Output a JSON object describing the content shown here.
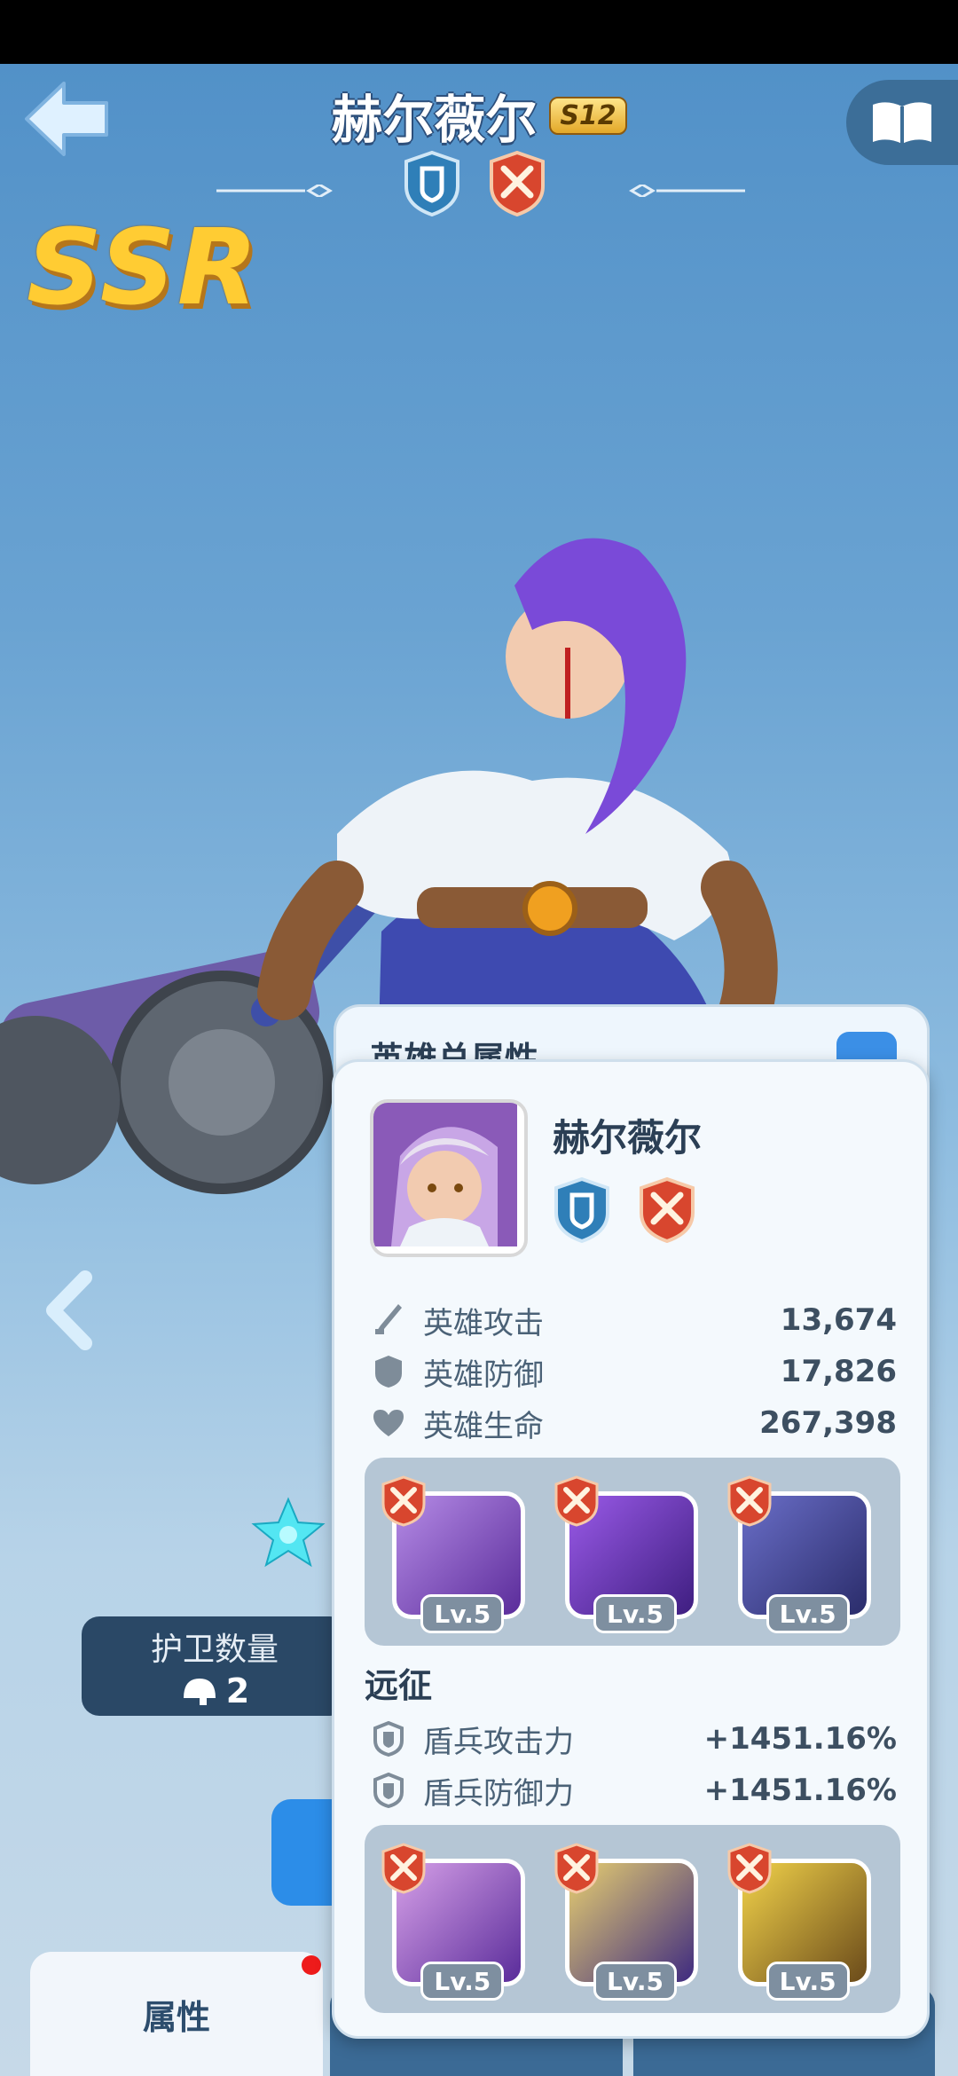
{
  "header": {
    "title": "赫尔薇尔",
    "star_badge": "S12",
    "rarity": "SSR"
  },
  "guard": {
    "label": "护卫数量",
    "value": "2"
  },
  "tabs": {
    "attributes": "属性"
  },
  "panel": {
    "back_title": "英雄总属性",
    "hero_name": "赫尔薇尔",
    "stats": [
      {
        "label": "英雄攻击",
        "value": "13,674",
        "icon": "sword-icon"
      },
      {
        "label": "英雄防御",
        "value": "17,826",
        "icon": "shield-icon"
      },
      {
        "label": "英雄生命",
        "value": "267,398",
        "icon": "heart-icon"
      }
    ],
    "skills_top": [
      {
        "level": "Lv.5",
        "color": "#7a3fb8"
      },
      {
        "level": "Lv.5",
        "color": "#5b2fa0"
      },
      {
        "level": "Lv.5",
        "color": "#3c3f8e"
      }
    ],
    "expedition_title": "远征",
    "expedition_stats": [
      {
        "label": "盾兵攻击力",
        "value": "+1451.16%"
      },
      {
        "label": "盾兵防御力",
        "value": "+1451.16%"
      }
    ],
    "skills_bottom": [
      {
        "level": "Lv.5",
        "color": "#6a3aa8"
      },
      {
        "level": "Lv.5",
        "color": "#4a3090"
      },
      {
        "level": "Lv.5",
        "color": "#6e4a1a"
      }
    ]
  },
  "colors": {
    "accent_blue": "#2c8de8",
    "ssr_gold": "#ffcc33",
    "badge_red": "#d8462e"
  }
}
